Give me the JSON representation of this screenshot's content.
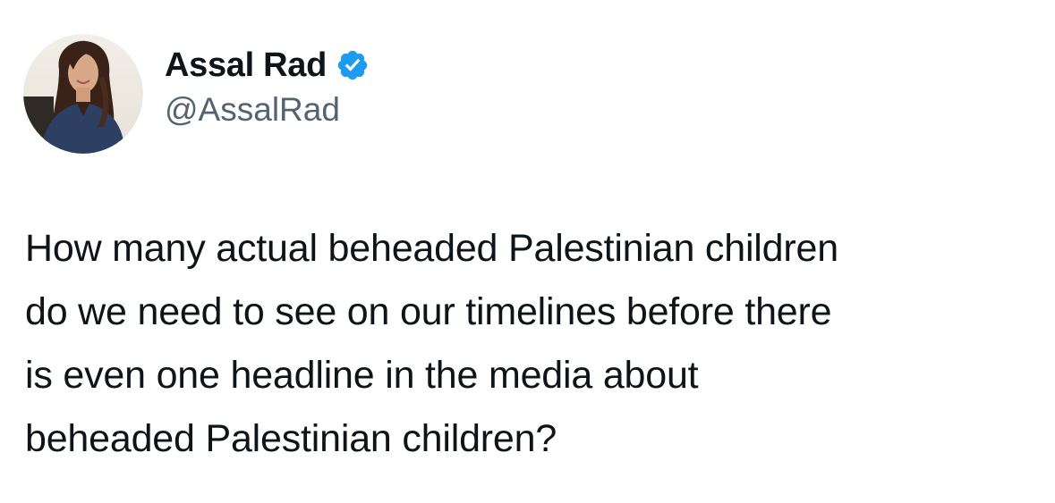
{
  "tweet": {
    "author": {
      "display_name": "Assal Rad",
      "handle": "@AssalRad",
      "verified": true,
      "verified_color": "#1d9bf0"
    },
    "text_lines": [
      "How many actual beheaded Palestinian children",
      "do we need to see on our timelines before there",
      "is even one headline in the media about",
      "beheaded Palestinian children?"
    ]
  },
  "icons": {
    "verified": "verified-badge-icon",
    "avatar": "user-avatar"
  }
}
